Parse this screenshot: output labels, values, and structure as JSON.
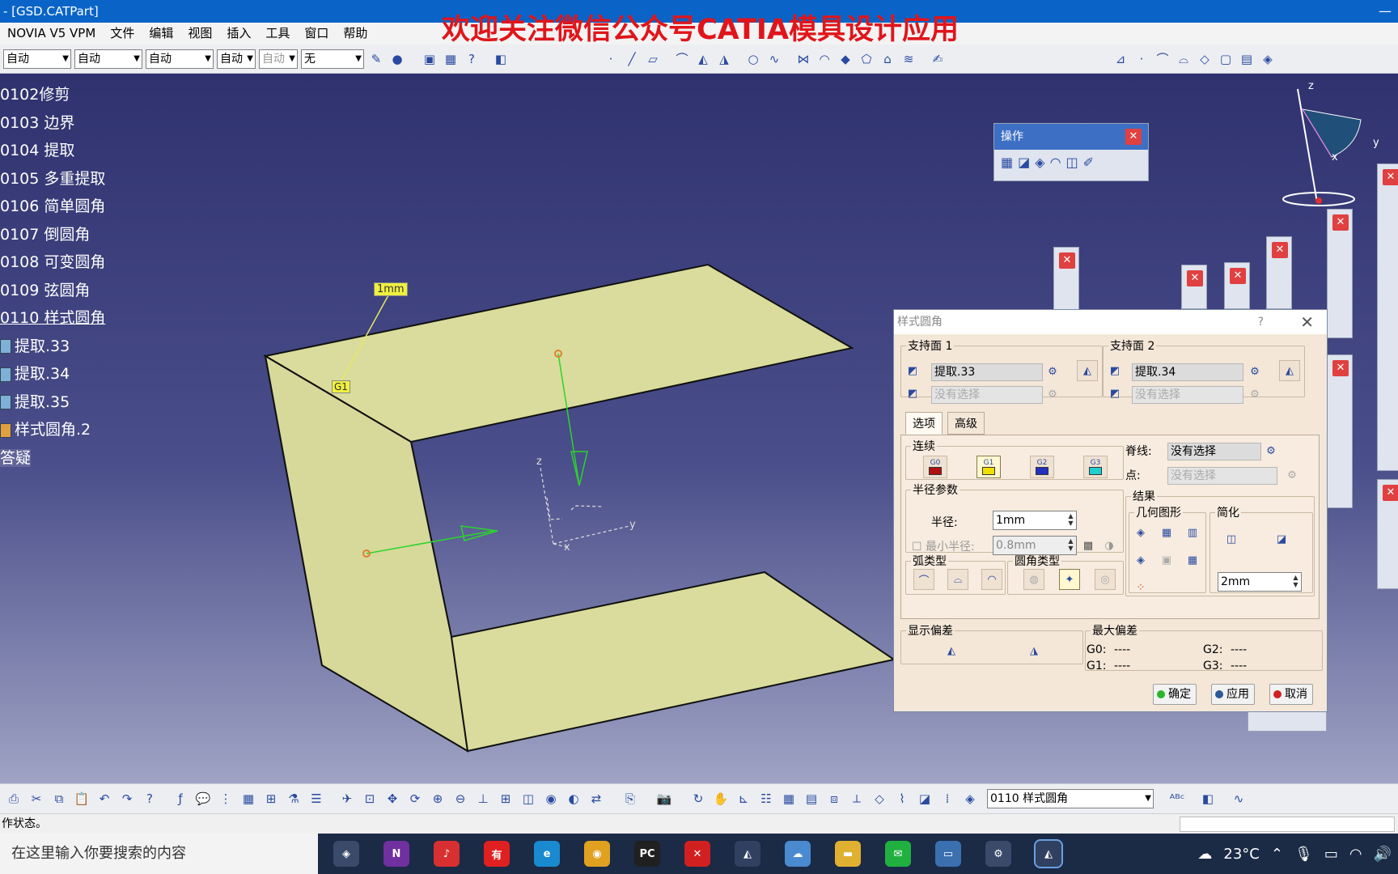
{
  "window": {
    "title": "- [GSD.CATPart]",
    "watermark": "欢迎关注微信公众号CATIA模具设计应用"
  },
  "menu": [
    "NOVIA V5 VPM",
    "文件",
    "编辑",
    "视图",
    "插入",
    "工具",
    "窗口",
    "帮助"
  ],
  "toolbar": {
    "combos": [
      "自动",
      "自动",
      "自动",
      "自动",
      "自动",
      "无"
    ],
    "bottom_combo": "0110 样式圆角"
  },
  "tree": {
    "items": [
      "0102修剪",
      "0103 边界",
      "0104 提取",
      "0105 多重提取",
      "0106 简单圆角",
      "0107 倒圆角",
      "0108 可变圆角",
      "0109 弦圆角",
      "0110 样式圆角"
    ],
    "features": [
      "提取.33",
      "提取.34",
      "提取.35",
      "样式圆角.2"
    ],
    "last": "答疑"
  },
  "viewport": {
    "radius_tag": "1mm",
    "continuity_tag": "G1",
    "axis_z": "z",
    "axis_y": "y",
    "axis_x": "x"
  },
  "ops_toolbar": {
    "title": "操作"
  },
  "dialog": {
    "title": "样式圆角",
    "help": "?",
    "support1": {
      "label": "支持面 1",
      "value": "提取.33",
      "placeholder": "没有选择"
    },
    "support2": {
      "label": "支持面 2",
      "value": "提取.34",
      "placeholder": "没有选择"
    },
    "tabs": [
      "选项",
      "高级"
    ],
    "continuity": {
      "label": "连续",
      "items": [
        "G0",
        "G1",
        "G2",
        "G3"
      ]
    },
    "spine_label": "脊线:",
    "spine_value": "没有选择",
    "point_label": "点:",
    "point_value": "没有选择",
    "radius_params": {
      "label": "半径参数",
      "radius_label": "半径:",
      "radius_value": "1mm",
      "min_label": "最小半径:",
      "min_value": "0.8mm"
    },
    "result": {
      "label": "结果",
      "geometry": "几何图形",
      "simplify": "简化",
      "value": "2mm"
    },
    "arc_type": "弧类型",
    "fillet_type": "圆角类型",
    "show_dev": "显示偏差",
    "max_dev": {
      "label": "最大偏差",
      "g0": "G0:",
      "g1": "G1:",
      "g2": "G2:",
      "g3": "G3:",
      "v": "----"
    },
    "buttons": {
      "ok": "确定",
      "apply": "应用",
      "cancel": "取消"
    }
  },
  "status": {
    "text": "作状态。"
  },
  "taskbar": {
    "search": "在这里输入你要搜索的内容",
    "weather": "23°C"
  },
  "colors": {
    "titlebar": "#0a64c8",
    "watermark": "#e0151b",
    "surface": "#d9dc9c",
    "dialog_bg": "#f4e7d8"
  }
}
